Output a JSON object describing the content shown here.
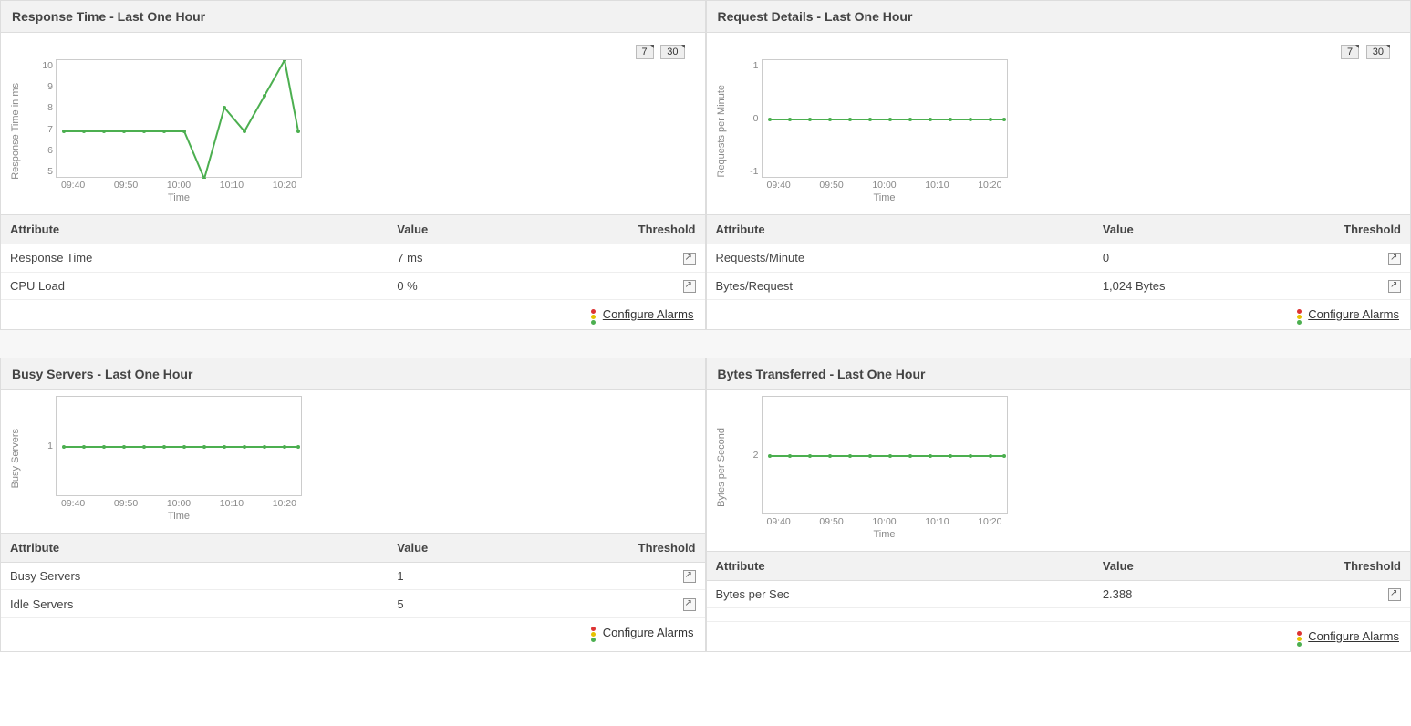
{
  "labels": {
    "attribute": "Attribute",
    "value": "Value",
    "threshold": "Threshold",
    "configure": "Configure Alarms",
    "btn7": "7",
    "btn30": "30",
    "timeLabel": "Time"
  },
  "panels": {
    "response": {
      "title": "Response Time - Last One Hour",
      "ylabel": "Response Time in ms",
      "rows": [
        {
          "attr": "Response Time",
          "val": "7 ms"
        },
        {
          "attr": "CPU Load",
          "val": "0 %"
        }
      ]
    },
    "request": {
      "title": "Request Details - Last One Hour",
      "ylabel": "Requests per Minute",
      "rows": [
        {
          "attr": "Requests/Minute",
          "val": "0"
        },
        {
          "attr": "Bytes/Request",
          "val": "1,024 Bytes"
        }
      ]
    },
    "busy": {
      "title": "Busy Servers - Last One Hour",
      "ylabel": "Busy Servers",
      "rows": [
        {
          "attr": "Busy Servers",
          "val": "1"
        },
        {
          "attr": "Idle Servers",
          "val": "5"
        }
      ]
    },
    "bytes": {
      "title": "Bytes Transferred - Last One Hour",
      "ylabel": "Bytes per Second",
      "rows": [
        {
          "attr": "Bytes per Sec",
          "val": "2.388"
        }
      ]
    }
  },
  "chart_data": [
    {
      "type": "line",
      "panel": "response",
      "title": "Response Time - Last One Hour",
      "xlabel": "Time",
      "ylabel": "Response Time in ms",
      "ylim": [
        5,
        10
      ],
      "yticks": [
        5,
        6,
        7,
        8,
        9,
        10
      ],
      "categories": [
        "09:40",
        "09:50",
        "10:00",
        "10:10",
        "10:20"
      ],
      "values": [
        7,
        7,
        7,
        7,
        7,
        7,
        7,
        5,
        8,
        7,
        8.5,
        10,
        7
      ]
    },
    {
      "type": "line",
      "panel": "request",
      "title": "Request Details - Last One Hour",
      "xlabel": "Time",
      "ylabel": "Requests per Minute",
      "ylim": [
        -1,
        1
      ],
      "yticks": [
        -1,
        0,
        1
      ],
      "categories": [
        "09:40",
        "09:50",
        "10:00",
        "10:10",
        "10:20"
      ],
      "values": [
        0,
        0,
        0,
        0,
        0,
        0,
        0,
        0,
        0,
        0,
        0,
        0,
        0
      ]
    },
    {
      "type": "line",
      "panel": "busy",
      "title": "Busy Servers - Last One Hour",
      "xlabel": "Time",
      "ylabel": "Busy Servers",
      "ylim": [
        0.5,
        1.5
      ],
      "yticks": [
        1
      ],
      "categories": [
        "09:40",
        "09:50",
        "10:00",
        "10:10",
        "10:20"
      ],
      "values": [
        1,
        1,
        1,
        1,
        1,
        1,
        1,
        1,
        1,
        1,
        1,
        1,
        1
      ]
    },
    {
      "type": "line",
      "panel": "bytes",
      "title": "Bytes Transferred - Last One Hour",
      "xlabel": "Time",
      "ylabel": "Bytes per Second",
      "ylim": [
        1.5,
        2.5
      ],
      "yticks": [
        2
      ],
      "categories": [
        "09:40",
        "09:50",
        "10:00",
        "10:10",
        "10:20"
      ],
      "values": [
        2,
        2,
        2,
        2,
        2,
        2,
        2,
        2,
        2,
        2,
        2,
        2,
        2
      ]
    }
  ]
}
